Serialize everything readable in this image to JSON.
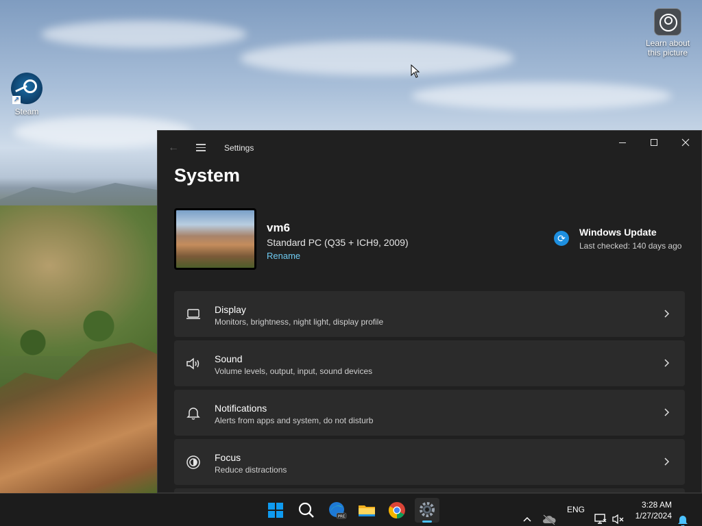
{
  "desktop": {
    "icons": [
      {
        "label": "Steam"
      },
      {
        "label": "Learn about this picture"
      }
    ]
  },
  "settings": {
    "app_title": "Settings",
    "page_title": "System",
    "device": {
      "name": "vm6",
      "model": "Standard PC (Q35 + ICH9, 2009)",
      "rename_label": "Rename"
    },
    "windows_update": {
      "title": "Windows Update",
      "subtitle": "Last checked: 140 days ago"
    },
    "items": [
      {
        "title": "Display",
        "subtitle": "Monitors, brightness, night light, display profile",
        "icon": "laptop-icon"
      },
      {
        "title": "Sound",
        "subtitle": "Volume levels, output, input, sound devices",
        "icon": "speaker-icon"
      },
      {
        "title": "Notifications",
        "subtitle": "Alerts from apps and system, do not disturb",
        "icon": "bell-icon"
      },
      {
        "title": "Focus",
        "subtitle": "Reduce distractions",
        "icon": "focus-icon"
      }
    ]
  },
  "taskbar": {
    "apps": [
      "start-icon",
      "search-icon",
      "edge-icon",
      "file-explorer-icon",
      "chrome-icon",
      "settings-icon"
    ],
    "tray": {
      "language": "ENG",
      "time": "3:28 AM",
      "date": "1/27/2024"
    }
  },
  "colors": {
    "accent": "#4cc2ff",
    "link": "#6fcbf2",
    "window_bg": "#202020",
    "card_bg": "#2b2b2b"
  }
}
